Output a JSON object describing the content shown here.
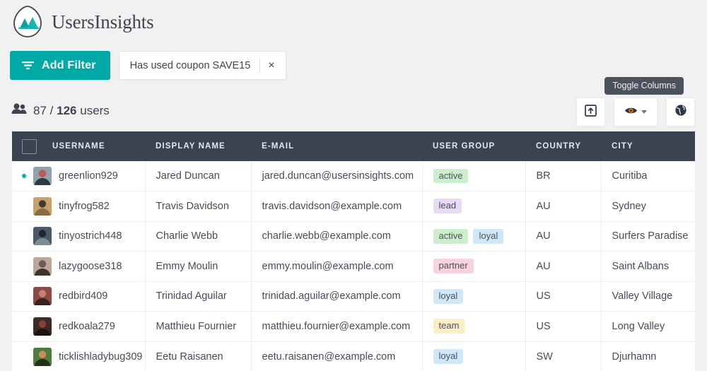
{
  "brand": {
    "name": "UsersInsights",
    "logo_icon": "mountain-drop-logo",
    "accent_color": "#00a9a5"
  },
  "toolbar": {
    "add_filter_label": "Add Filter",
    "filter_icon": "funnel-icon",
    "active_filter": {
      "label": "Has used coupon SAVE15",
      "remove_icon": "close-icon",
      "remove_label": "×"
    }
  },
  "summary": {
    "icon": "users-icon",
    "shown": "87",
    "separator": "/",
    "total": "126",
    "unit": "users"
  },
  "actions": {
    "tooltip": "Toggle Columns",
    "buttons": [
      {
        "name": "export-button",
        "icon": "export-box-icon"
      },
      {
        "name": "toggle-columns-button",
        "icon": "eye-icon",
        "caret": "chevron-down-icon"
      },
      {
        "name": "globe-button",
        "icon": "globe-icon"
      }
    ]
  },
  "table": {
    "select_all_checkbox": "select-all-checkbox",
    "columns": [
      "USERNAME",
      "DISPLAY NAME",
      "E-MAIL",
      "USER GROUP",
      "COUNTRY",
      "CITY"
    ],
    "rows": [
      {
        "status_dot": true,
        "username": "greenlion929",
        "display_name": "Jared Duncan",
        "email": "jared.duncan@usersinsights.com",
        "groups": [
          "active"
        ],
        "country": "BR",
        "city": "Curitiba"
      },
      {
        "status_dot": false,
        "username": "tinyfrog582",
        "display_name": "Travis Davidson",
        "email": "travis.davidson@example.com",
        "groups": [
          "lead"
        ],
        "country": "AU",
        "city": "Sydney"
      },
      {
        "status_dot": false,
        "username": "tinyostrich448",
        "display_name": "Charlie Webb",
        "email": "charlie.webb@example.com",
        "groups": [
          "active",
          "loyal"
        ],
        "country": "AU",
        "city": "Surfers Paradise"
      },
      {
        "status_dot": false,
        "username": "lazygoose318",
        "display_name": "Emmy Moulin",
        "email": "emmy.moulin@example.com",
        "groups": [
          "partner"
        ],
        "country": "AU",
        "city": "Saint Albans"
      },
      {
        "status_dot": false,
        "username": "redbird409",
        "display_name": "Trinidad Aguilar",
        "email": "trinidad.aguilar@example.com",
        "groups": [
          "loyal"
        ],
        "country": "US",
        "city": "Valley Village"
      },
      {
        "status_dot": false,
        "username": "redkoala279",
        "display_name": "Matthieu Fournier",
        "email": "matthieu.fournier@example.com",
        "groups": [
          "team"
        ],
        "country": "US",
        "city": "Long Valley"
      },
      {
        "status_dot": false,
        "username": "ticklishladybug309",
        "display_name": "Eetu Raisanen",
        "email": "eetu.raisanen@example.com",
        "groups": [
          "loyal"
        ],
        "country": "SW",
        "city": "Djurhamn"
      }
    ],
    "badge_colors": {
      "active": "#cdeecd",
      "lead": "#e6daf5",
      "loyal": "#cfe7f7",
      "partner": "#f7d3de",
      "team": "#fbeec4"
    },
    "header_bg": "#3c4350"
  }
}
